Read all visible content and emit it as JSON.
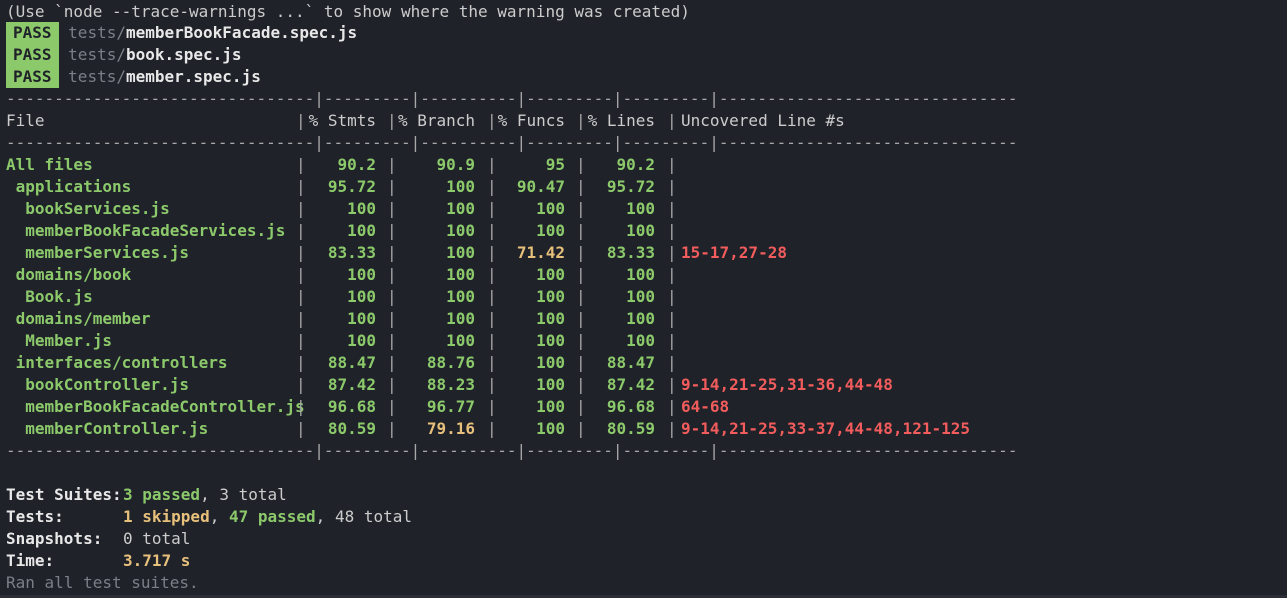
{
  "warning_line": "(Use `node --trace-warnings ...` to show where the warning was created)",
  "pass_results": [
    {
      "badge": "PASS",
      "dir": "tests/",
      "file": "memberBookFacade.spec.js"
    },
    {
      "badge": "PASS",
      "dir": "tests/",
      "file": "book.spec.js"
    },
    {
      "badge": "PASS",
      "dir": "tests/",
      "file": "member.spec.js"
    }
  ],
  "coverage": {
    "divider": "--------------------------------|---------|----------|---------|---------|-------------------------------",
    "header": {
      "file": "File",
      "stmts": "% Stmts",
      "branch": "% Branch",
      "funcs": "% Funcs",
      "lines": "% Lines",
      "uncovered": "Uncovered Line #s"
    },
    "rows": [
      {
        "file": "All files",
        "stmts": "90.2",
        "branch": "90.9",
        "funcs": "95",
        "lines": "90.2",
        "uncovered": ""
      },
      {
        "file": " applications",
        "stmts": "95.72",
        "branch": "100",
        "funcs": "90.47",
        "lines": "95.72",
        "uncovered": ""
      },
      {
        "file": "  bookServices.js",
        "stmts": "100",
        "branch": "100",
        "funcs": "100",
        "lines": "100",
        "uncovered": ""
      },
      {
        "file": "  memberBookFacadeServices.js",
        "stmts": "100",
        "branch": "100",
        "funcs": "100",
        "lines": "100",
        "uncovered": ""
      },
      {
        "file": "  memberServices.js",
        "stmts": "83.33",
        "branch": "100",
        "funcs": "71.42",
        "lines": "83.33",
        "uncovered": "15-17,27-28"
      },
      {
        "file": " domains/book",
        "stmts": "100",
        "branch": "100",
        "funcs": "100",
        "lines": "100",
        "uncovered": ""
      },
      {
        "file": "  Book.js",
        "stmts": "100",
        "branch": "100",
        "funcs": "100",
        "lines": "100",
        "uncovered": ""
      },
      {
        "file": " domains/member",
        "stmts": "100",
        "branch": "100",
        "funcs": "100",
        "lines": "100",
        "uncovered": ""
      },
      {
        "file": "  Member.js",
        "stmts": "100",
        "branch": "100",
        "funcs": "100",
        "lines": "100",
        "uncovered": ""
      },
      {
        "file": " interfaces/controllers",
        "stmts": "88.47",
        "branch": "88.76",
        "funcs": "100",
        "lines": "88.47",
        "uncovered": ""
      },
      {
        "file": "  bookController.js",
        "stmts": "87.42",
        "branch": "88.23",
        "funcs": "100",
        "lines": "87.42",
        "uncovered": "9-14,21-25,31-36,44-48"
      },
      {
        "file": "  memberBookFacadeController.js",
        "stmts": "96.68",
        "branch": "96.77",
        "funcs": "100",
        "lines": "96.68",
        "uncovered": "64-68"
      },
      {
        "file": "  memberController.js",
        "stmts": "80.59",
        "branch": "79.16",
        "funcs": "100",
        "lines": "80.59",
        "uncovered": "9-14,21-25,33-37,44-48,121-125"
      }
    ]
  },
  "summary": {
    "suites_label": "Test Suites:",
    "suites_passed": "3 passed",
    "suites_total": ", 3 total",
    "tests_label": "Tests:",
    "tests_skipped": "1 skipped",
    "tests_sep": ", ",
    "tests_passed": "47 passed",
    "tests_total": ", 48 total",
    "snapshots_label": "Snapshots:",
    "snapshots_value": "0 total",
    "time_label": "Time:",
    "time_value": "3.717 s",
    "footer": "Ran all test suites."
  },
  "colors": {
    "background": "#1f2229",
    "pass_green": "#8cc96b",
    "warn_yellow": "#e7c07b",
    "fail_red": "#f25c5c",
    "dim_gray": "#7b7f87"
  }
}
